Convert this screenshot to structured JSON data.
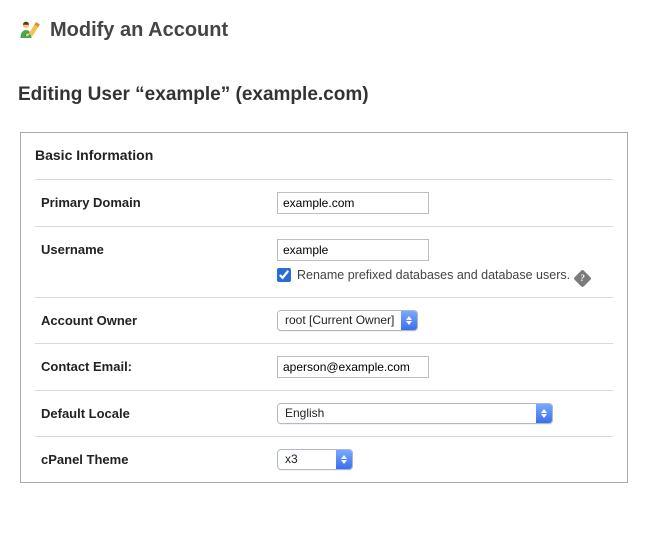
{
  "header": {
    "title": "Modify an Account"
  },
  "editing_heading": "Editing User “example” (example.com)",
  "panel": {
    "title": "Basic Information",
    "fields": {
      "primary_domain": {
        "label": "Primary Domain",
        "value": "example.com"
      },
      "username": {
        "label": "Username",
        "value": "example",
        "rename_checkbox_label": "Rename prefixed databases and database users.",
        "rename_checked": true
      },
      "account_owner": {
        "label": "Account Owner",
        "selected": "root [Current Owner]"
      },
      "contact_email": {
        "label": "Contact Email:",
        "value": "aperson@example.com"
      },
      "default_locale": {
        "label": "Default Locale",
        "selected": "English"
      },
      "cpanel_theme": {
        "label": "cPanel Theme",
        "selected": "x3"
      }
    }
  }
}
